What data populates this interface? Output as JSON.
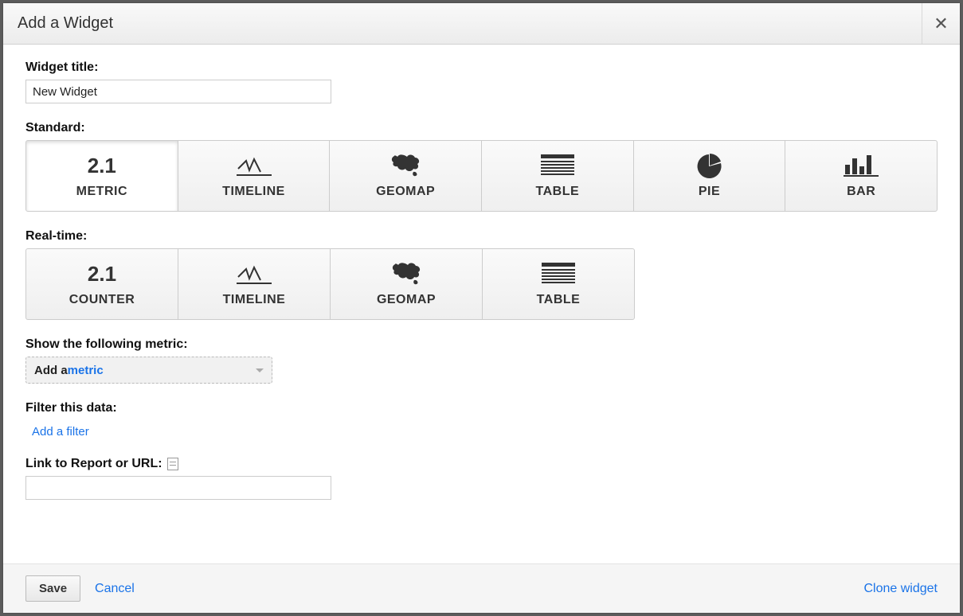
{
  "dialog": {
    "title": "Add a Widget"
  },
  "labels": {
    "widget_title": "Widget title:",
    "standard": "Standard:",
    "realtime": "Real-time:",
    "show_metric": "Show the following metric:",
    "filter_data": "Filter this data:",
    "link_to": "Link to Report or URL:"
  },
  "inputs": {
    "widget_title_value": "New Widget",
    "link_value": ""
  },
  "standard_tiles": [
    {
      "id": "metric",
      "label": "METRIC",
      "icon": "number",
      "selected": true
    },
    {
      "id": "timeline",
      "label": "TIMELINE",
      "icon": "timeline",
      "selected": false
    },
    {
      "id": "geomap",
      "label": "GEOMAP",
      "icon": "geomap",
      "selected": false
    },
    {
      "id": "table",
      "label": "TABLE",
      "icon": "table",
      "selected": false
    },
    {
      "id": "pie",
      "label": "PIE",
      "icon": "pie",
      "selected": false
    },
    {
      "id": "bar",
      "label": "BAR",
      "icon": "bar",
      "selected": false
    }
  ],
  "realtime_tiles": [
    {
      "id": "counter",
      "label": "COUNTER",
      "icon": "number"
    },
    {
      "id": "timeline",
      "label": "TIMELINE",
      "icon": "timeline"
    },
    {
      "id": "geomap",
      "label": "GEOMAP",
      "icon": "geomap"
    },
    {
      "id": "table",
      "label": "TABLE",
      "icon": "table"
    }
  ],
  "metric_dropdown": {
    "prefix": "Add a ",
    "link": "metric"
  },
  "filter": {
    "add_filter_label": "Add a filter"
  },
  "footer": {
    "save": "Save",
    "cancel": "Cancel",
    "clone": "Clone widget"
  },
  "icon_number_text": "2.1"
}
